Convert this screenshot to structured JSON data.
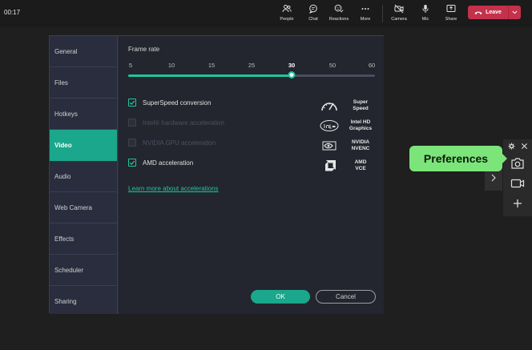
{
  "topbar": {
    "timer": "00:17",
    "buttons": {
      "people": "People",
      "chat": "Chat",
      "reactions": "Reactions",
      "more": "More",
      "camera": "Camera",
      "mic": "Mic",
      "share": "Share"
    },
    "leave_label": "Leave"
  },
  "sidebar": {
    "items": [
      {
        "label": "General"
      },
      {
        "label": "Files"
      },
      {
        "label": "Hotkeys"
      },
      {
        "label": "Video"
      },
      {
        "label": "Audio"
      },
      {
        "label": "Web Camera"
      },
      {
        "label": "Effects"
      },
      {
        "label": "Scheduler"
      },
      {
        "label": "Sharing"
      }
    ],
    "active": "Video"
  },
  "video": {
    "frame_rate_title": "Frame rate",
    "frame_rate_ticks": [
      "5",
      "10",
      "15",
      "25",
      "30",
      "50",
      "60"
    ],
    "frame_rate_selected": "30",
    "options": [
      {
        "label": "SuperSpeed conversion",
        "checked": true,
        "disabled": false,
        "brand_line1": "Super",
        "brand_line2": "Speed",
        "brand_icon": "speedometer-icon"
      },
      {
        "label": "Intel® hardware acceleration",
        "checked": false,
        "disabled": true,
        "brand_line1": "Intel HD",
        "brand_line2": "Graphics",
        "brand_icon": "intel-logo-icon"
      },
      {
        "label": "NVIDIA GPU acceleration",
        "checked": false,
        "disabled": true,
        "brand_line1": "NVIDIA",
        "brand_line2": "NVENC",
        "brand_icon": "nvidia-logo-icon"
      },
      {
        "label": "AMD acceleration",
        "checked": true,
        "disabled": false,
        "brand_line1": "AMD",
        "brand_line2": "VCE",
        "brand_icon": "amd-logo-icon"
      }
    ],
    "learn_more": "Learn more about accelerations",
    "ok_label": "OK",
    "cancel_label": "Cancel"
  },
  "tooltip": {
    "text": "Preferences"
  },
  "colors": {
    "accent": "#1aa78b",
    "leave": "#c4314b",
    "tooltip": "#7ce57a"
  }
}
